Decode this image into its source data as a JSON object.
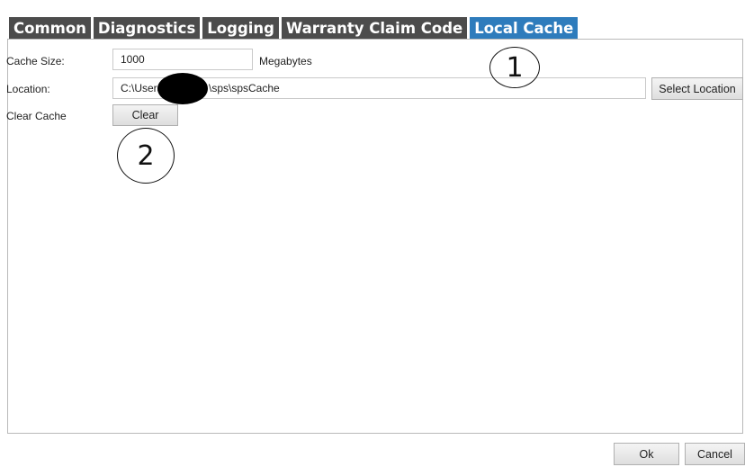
{
  "tabs": [
    {
      "label": "Common"
    },
    {
      "label": "Diagnostics"
    },
    {
      "label": "Logging"
    },
    {
      "label": "Warranty Claim Code"
    },
    {
      "label": "Local Cache",
      "active": true
    }
  ],
  "cache_size": {
    "label": "Cache Size:",
    "value": "1000",
    "unit": "Megabytes"
  },
  "location": {
    "label": "Location:",
    "value": "C:\\Users\\    \\sps\\spsCache",
    "button": "Select Location"
  },
  "clear_cache": {
    "label": "Clear Cache",
    "button": "Clear"
  },
  "callouts": [
    "1",
    "2"
  ],
  "footer": {
    "ok": "Ok",
    "cancel": "Cancel"
  },
  "colors": {
    "active_tab": "#2e7cbc",
    "inactive_tab": "#4c4c4c"
  }
}
